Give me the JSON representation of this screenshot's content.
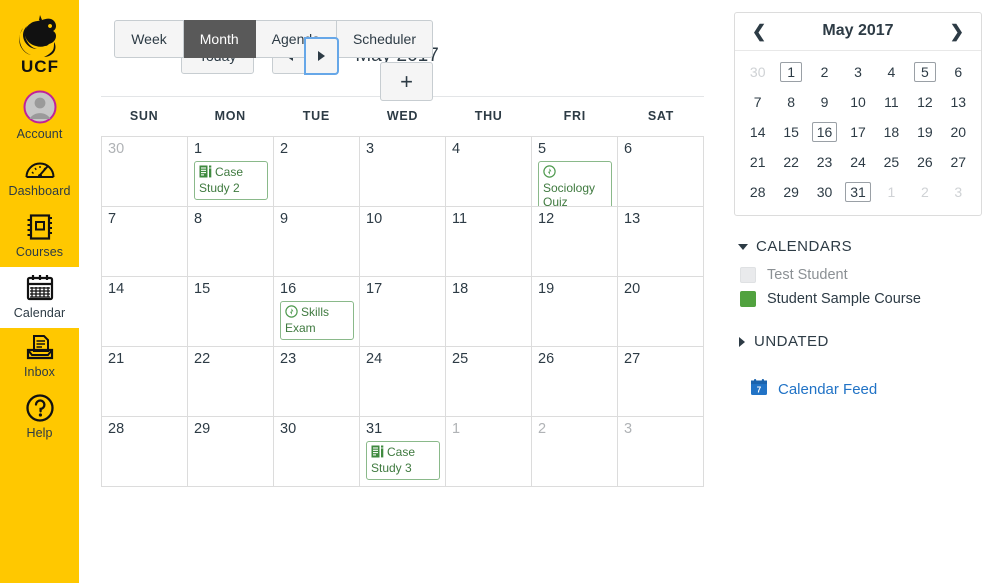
{
  "global_nav": {
    "logo": {
      "name": "UCF",
      "icon": "ucf-pegasus-logo"
    },
    "items": [
      {
        "label": "Account",
        "icon": "avatar-icon",
        "active": false
      },
      {
        "label": "Dashboard",
        "icon": "dashboard-gauge-icon",
        "active": false
      },
      {
        "label": "Courses",
        "icon": "courses-book-icon",
        "active": false
      },
      {
        "label": "Calendar",
        "icon": "calendar-icon",
        "active": true
      },
      {
        "label": "Inbox",
        "icon": "inbox-tray-icon",
        "active": false
      },
      {
        "label": "Help",
        "icon": "help-question-icon",
        "active": false
      }
    ],
    "brand_color": "#FFC800"
  },
  "toolbar": {
    "today_label": "Today",
    "prev_label": "prev-month-arrow",
    "next_label": "next-month-arrow",
    "month_title": "May 2017",
    "views": [
      {
        "label": "Week",
        "selected": false
      },
      {
        "label": "Month",
        "selected": true
      },
      {
        "label": "Agenda",
        "selected": false
      },
      {
        "label": "Scheduler",
        "selected": false
      }
    ],
    "add_label": "+",
    "selected_view_bg": "#595959"
  },
  "calendar": {
    "day_headers": [
      "SUN",
      "MON",
      "TUE",
      "WED",
      "THU",
      "FRI",
      "SAT"
    ],
    "event_color": "#3f7a3f",
    "event_border_color": "#8ab98a",
    "weeks": [
      [
        {
          "num": "30",
          "other": true,
          "events": []
        },
        {
          "num": "1",
          "other": false,
          "events": [
            {
              "title": "Case Study 2",
              "icon": "assignment-icon"
            }
          ]
        },
        {
          "num": "2",
          "other": false,
          "events": []
        },
        {
          "num": "3",
          "other": false,
          "events": []
        },
        {
          "num": "4",
          "other": false,
          "events": []
        },
        {
          "num": "5",
          "other": false,
          "events": [
            {
              "title": "Sociology Quiz",
              "icon": "quiz-icon"
            }
          ]
        },
        {
          "num": "6",
          "other": false,
          "events": []
        }
      ],
      [
        {
          "num": "7",
          "other": false,
          "events": []
        },
        {
          "num": "8",
          "other": false,
          "events": []
        },
        {
          "num": "9",
          "other": false,
          "events": []
        },
        {
          "num": "10",
          "other": false,
          "events": []
        },
        {
          "num": "11",
          "other": false,
          "events": []
        },
        {
          "num": "12",
          "other": false,
          "events": []
        },
        {
          "num": "13",
          "other": false,
          "events": []
        }
      ],
      [
        {
          "num": "14",
          "other": false,
          "events": []
        },
        {
          "num": "15",
          "other": false,
          "events": []
        },
        {
          "num": "16",
          "other": false,
          "events": [
            {
              "title": "Skills Exam",
              "icon": "quiz-icon"
            }
          ]
        },
        {
          "num": "17",
          "other": false,
          "events": []
        },
        {
          "num": "18",
          "other": false,
          "events": []
        },
        {
          "num": "19",
          "other": false,
          "events": []
        },
        {
          "num": "20",
          "other": false,
          "events": []
        }
      ],
      [
        {
          "num": "21",
          "other": false,
          "events": []
        },
        {
          "num": "22",
          "other": false,
          "events": []
        },
        {
          "num": "23",
          "other": false,
          "events": []
        },
        {
          "num": "24",
          "other": false,
          "events": []
        },
        {
          "num": "25",
          "other": false,
          "events": []
        },
        {
          "num": "26",
          "other": false,
          "events": []
        },
        {
          "num": "27",
          "other": false,
          "events": []
        }
      ],
      [
        {
          "num": "28",
          "other": false,
          "events": []
        },
        {
          "num": "29",
          "other": false,
          "events": []
        },
        {
          "num": "30",
          "other": false,
          "events": []
        },
        {
          "num": "31",
          "other": false,
          "events": [
            {
              "title": "Case Study 3",
              "icon": "assignment-icon"
            }
          ]
        },
        {
          "num": "1",
          "other": true,
          "events": []
        },
        {
          "num": "2",
          "other": true,
          "events": []
        },
        {
          "num": "3",
          "other": true,
          "events": []
        }
      ]
    ]
  },
  "mini_calendar": {
    "title": "May 2017",
    "prev_icon": "chevron-left-icon",
    "next_icon": "chevron-right-icon",
    "days": [
      {
        "num": "30",
        "other": true,
        "has_event": false
      },
      {
        "num": "1",
        "other": false,
        "has_event": true
      },
      {
        "num": "2",
        "other": false,
        "has_event": false
      },
      {
        "num": "3",
        "other": false,
        "has_event": false
      },
      {
        "num": "4",
        "other": false,
        "has_event": false
      },
      {
        "num": "5",
        "other": false,
        "has_event": true
      },
      {
        "num": "6",
        "other": false,
        "has_event": false
      },
      {
        "num": "7",
        "other": false,
        "has_event": false
      },
      {
        "num": "8",
        "other": false,
        "has_event": false
      },
      {
        "num": "9",
        "other": false,
        "has_event": false
      },
      {
        "num": "10",
        "other": false,
        "has_event": false
      },
      {
        "num": "11",
        "other": false,
        "has_event": false
      },
      {
        "num": "12",
        "other": false,
        "has_event": false
      },
      {
        "num": "13",
        "other": false,
        "has_event": false
      },
      {
        "num": "14",
        "other": false,
        "has_event": false
      },
      {
        "num": "15",
        "other": false,
        "has_event": false
      },
      {
        "num": "16",
        "other": false,
        "has_event": true
      },
      {
        "num": "17",
        "other": false,
        "has_event": false
      },
      {
        "num": "18",
        "other": false,
        "has_event": false
      },
      {
        "num": "19",
        "other": false,
        "has_event": false
      },
      {
        "num": "20",
        "other": false,
        "has_event": false
      },
      {
        "num": "21",
        "other": false,
        "has_event": false
      },
      {
        "num": "22",
        "other": false,
        "has_event": false
      },
      {
        "num": "23",
        "other": false,
        "has_event": false
      },
      {
        "num": "24",
        "other": false,
        "has_event": false
      },
      {
        "num": "25",
        "other": false,
        "has_event": false
      },
      {
        "num": "26",
        "other": false,
        "has_event": false
      },
      {
        "num": "27",
        "other": false,
        "has_event": false
      },
      {
        "num": "28",
        "other": false,
        "has_event": false
      },
      {
        "num": "29",
        "other": false,
        "has_event": false
      },
      {
        "num": "30",
        "other": false,
        "has_event": false
      },
      {
        "num": "31",
        "other": false,
        "has_event": true
      },
      {
        "num": "1",
        "other": true,
        "has_event": false
      },
      {
        "num": "2",
        "other": true,
        "has_event": false
      },
      {
        "num": "3",
        "other": true,
        "has_event": false
      }
    ]
  },
  "sidebar": {
    "calendars_title": "CALENDARS",
    "calendars_expanded": true,
    "calendars": [
      {
        "name": "Test Student",
        "checked": false,
        "color": "#e9eaec"
      },
      {
        "name": "Student Sample Course",
        "checked": true,
        "color": "#51a23f"
      }
    ],
    "undated_title": "UNDATED",
    "undated_expanded": false,
    "feed_label": "Calendar Feed",
    "feed_icon": "calendar-feed-icon",
    "feed_color": "#2173c6"
  }
}
